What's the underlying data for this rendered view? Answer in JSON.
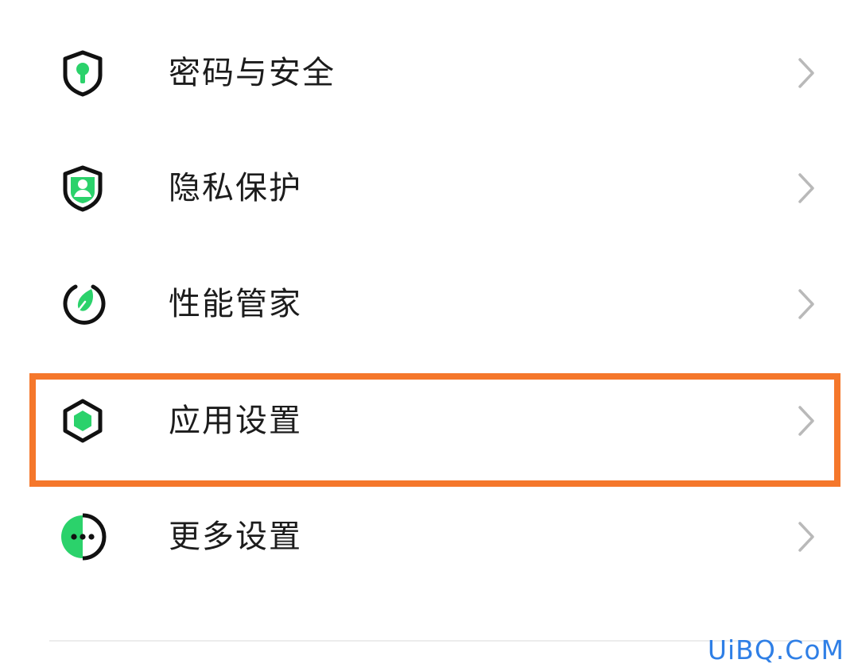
{
  "settings_list": {
    "items": [
      {
        "label": "密码与安全",
        "icon": "shield-lock-icon"
      },
      {
        "label": "隐私保护",
        "icon": "shield-person-icon"
      },
      {
        "label": "性能管家",
        "icon": "gauge-leaf-icon"
      },
      {
        "label": "应用设置",
        "icon": "hexagon-icon",
        "highlighted": true
      },
      {
        "label": "更多设置",
        "icon": "more-dots-icon"
      }
    ]
  },
  "colors": {
    "accent_green": "#2bd26b",
    "icon_outline": "#111111",
    "highlight_border": "#f5772b",
    "label_text": "#1c1c1c",
    "chevron": "#b9b9b9",
    "watermark": "#2f7fe6"
  },
  "watermark": {
    "text": "UiBQ.CoM"
  }
}
